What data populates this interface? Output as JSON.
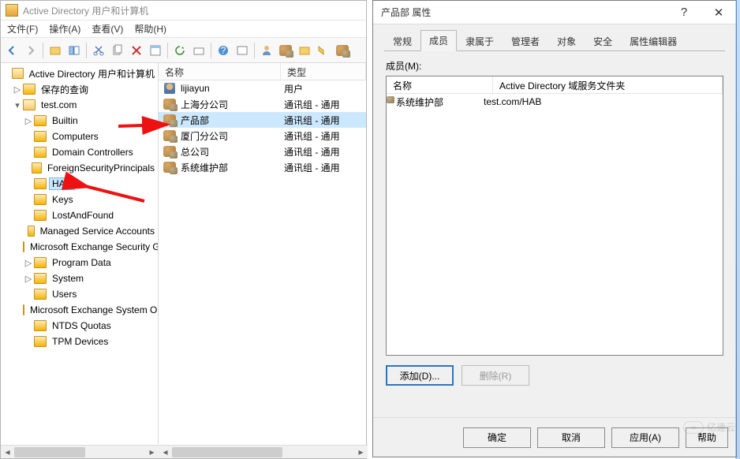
{
  "ad_window": {
    "title": "Active Directory 用户和计算机",
    "menus": {
      "file": "文件(F)",
      "action": "操作(A)",
      "view": "查看(V)",
      "help": "帮助(H)"
    },
    "tree": {
      "root": "Active Directory 用户和计算机",
      "saved": "保存的查询",
      "domain": "test.com",
      "nodes": [
        "Builtin",
        "Computers",
        "Domain Controllers",
        "ForeignSecurityPrincipals",
        "HAB",
        "Keys",
        "LostAndFound",
        "Managed Service Accounts",
        "Microsoft Exchange Security Groups",
        "Program Data",
        "System",
        "Users",
        "Microsoft Exchange System Objects",
        "NTDS Quotas",
        "TPM Devices"
      ],
      "selected": "HAB"
    },
    "list": {
      "col_name": "名称",
      "col_type": "类型",
      "rows": [
        {
          "name": "lijiayun",
          "type": "用户",
          "kind": "user"
        },
        {
          "name": "上海分公司",
          "type": "通讯组 - 通用",
          "kind": "group"
        },
        {
          "name": "产品部",
          "type": "通讯组 - 通用",
          "kind": "group",
          "selected": true
        },
        {
          "name": "厦门分公司",
          "type": "通讯组 - 通用",
          "kind": "group"
        },
        {
          "name": "总公司",
          "type": "通讯组 - 通用",
          "kind": "group"
        },
        {
          "name": "系统维护部",
          "type": "通讯组 - 通用",
          "kind": "group"
        }
      ]
    }
  },
  "dialog": {
    "title": "产品部 属性",
    "tabs": {
      "general": "常规",
      "members": "成员",
      "memberof": "隶属于",
      "managedby": "管理者",
      "object": "对象",
      "security": "安全",
      "attreditor": "属性编辑器"
    },
    "active_tab": "members",
    "members_label": "成员(M):",
    "members_cols": {
      "name": "名称",
      "folder": "Active Directory 域服务文件夹"
    },
    "members_rows": [
      {
        "name": "系统维护部",
        "folder": "test.com/HAB"
      }
    ],
    "buttons": {
      "add": "添加(D)...",
      "remove": "删除(R)"
    },
    "footer": {
      "ok": "确定",
      "cancel": "取消",
      "apply": "应用(A)",
      "help": "帮助"
    }
  },
  "watermark": "亿速云"
}
